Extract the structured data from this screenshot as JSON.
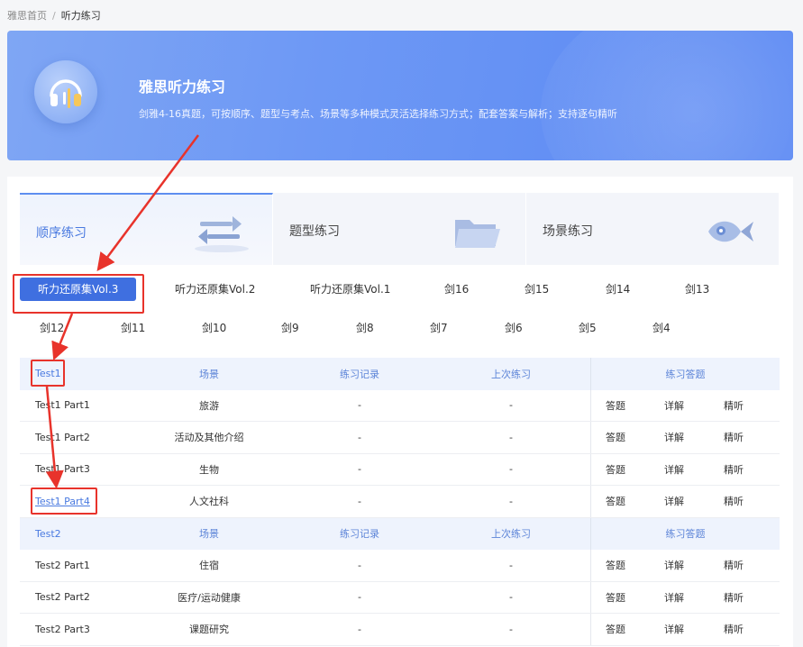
{
  "breadcrumb": {
    "home": "雅思首页",
    "separator": "/",
    "current": "听力练习"
  },
  "banner": {
    "title": "雅思听力练习",
    "description": "剑雅4-16真题，可按顺序、题型与考点、场景等多种模式灵活选择练习方式；配套答案与解析；支持逐句精听",
    "icon": "headphones-icon"
  },
  "modes": [
    {
      "label": "顺序练习",
      "icon": "swap-arrows-icon",
      "active": true
    },
    {
      "label": "题型练习",
      "icon": "folder-icon",
      "active": false
    },
    {
      "label": "场景练习",
      "icon": "fish-pin-icon",
      "active": false
    }
  ],
  "volumes_row1": [
    "听力还原集Vol.3",
    "听力还原集Vol.2",
    "听力还原集Vol.1",
    "剑16",
    "剑15",
    "剑14",
    "剑13"
  ],
  "volumes_row2": [
    "剑12",
    "剑11",
    "剑10",
    "剑9",
    "剑8",
    "剑7",
    "剑6",
    "剑5",
    "剑4"
  ],
  "active_volume": "听力还原集Vol.3",
  "table": {
    "groups": [
      {
        "header": {
          "name": "Test1",
          "scene": "场景",
          "record": "练习记录",
          "last": "上次练习",
          "actions": "练习答题"
        },
        "rows": [
          {
            "name": "Test1 Part1",
            "scene": "旅游",
            "record": "-",
            "last": "-",
            "a1": "答题",
            "a2": "详解",
            "a3": "精听"
          },
          {
            "name": "Test1 Part2",
            "scene": "活动及其他介绍",
            "record": "-",
            "last": "-",
            "a1": "答题",
            "a2": "详解",
            "a3": "精听"
          },
          {
            "name": "Test1 Part3",
            "scene": "生物",
            "record": "-",
            "last": "-",
            "a1": "答题",
            "a2": "详解",
            "a3": "精听"
          },
          {
            "name": "Test1 Part4",
            "scene": "人文社科",
            "record": "-",
            "last": "-",
            "a1": "答题",
            "a2": "详解",
            "a3": "精听"
          }
        ]
      },
      {
        "header": {
          "name": "Test2",
          "scene": "场景",
          "record": "练习记录",
          "last": "上次练习",
          "actions": "练习答题"
        },
        "rows": [
          {
            "name": "Test2 Part1",
            "scene": "住宿",
            "record": "-",
            "last": "-",
            "a1": "答题",
            "a2": "详解",
            "a3": "精听"
          },
          {
            "name": "Test2 Part2",
            "scene": "医疗/运动健康",
            "record": "-",
            "last": "-",
            "a1": "答题",
            "a2": "详解",
            "a3": "精听"
          },
          {
            "name": "Test2 Part3",
            "scene": "课题研究",
            "record": "-",
            "last": "-",
            "a1": "答题",
            "a2": "详解",
            "a3": "精听"
          }
        ]
      }
    ]
  },
  "colors": {
    "accent": "#3f6fe0",
    "link": "#4a7ae0",
    "annotation": "#e8332b",
    "header_bg": "#eef3fd"
  }
}
